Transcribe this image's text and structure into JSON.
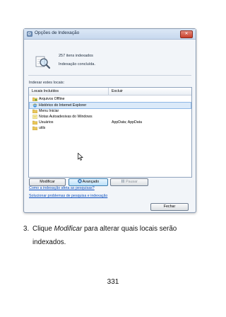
{
  "window": {
    "title": "Opções de Indexação",
    "close_glyph": "✕",
    "items_count": "257 itens indexados",
    "status": "Indexação concluída.",
    "list_label": "Indexar estes locais:"
  },
  "table": {
    "col_included": "Locais Incluídos",
    "col_exclude": "Excluir",
    "rows": [
      {
        "label": "Arquivos Offline",
        "exclude": "",
        "icon": "offline-files-icon"
      },
      {
        "label": "Histórico do Internet Explorer",
        "exclude": "",
        "icon": "ie-history-icon",
        "selected": true
      },
      {
        "label": "Menu Iniciar",
        "exclude": "",
        "icon": "folder-icon"
      },
      {
        "label": "Notas Autoadesivas do Windows",
        "exclude": "",
        "icon": "sticky-notes-icon"
      },
      {
        "label": "Usuários",
        "exclude": "AppData; AppData",
        "icon": "folder-icon"
      },
      {
        "label": "utils",
        "exclude": "",
        "icon": "folder-icon"
      }
    ]
  },
  "buttons": {
    "modify": "Modificar",
    "advanced": "Avançado",
    "pause": "Pausar",
    "close": "Fechar"
  },
  "links": {
    "how_affects": "Como a indexação afeta as pesquisas?",
    "troubleshoot": "Solucionar problemas de pesquisa e indexação"
  },
  "text": {
    "step_number": "3.",
    "step_prefix": "Clique ",
    "step_em": "Modificar",
    "step_suffix": " para alterar quais locais serão indexados.",
    "page_number": "331"
  },
  "colors": {
    "folder": "#e9c65a",
    "selection": "#dbeaf9",
    "link": "#0b4fbf"
  }
}
